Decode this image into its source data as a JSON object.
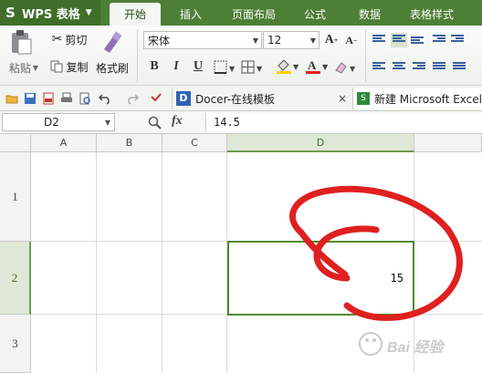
{
  "app": {
    "name": "WPS 表格"
  },
  "menu_tabs": [
    {
      "label": "开始",
      "active": true
    },
    {
      "label": "插入"
    },
    {
      "label": "页面布局"
    },
    {
      "label": "公式"
    },
    {
      "label": "数据"
    },
    {
      "label": "表格样式"
    }
  ],
  "ribbon": {
    "paste": "粘贴",
    "cut": "剪切",
    "copy": "复制",
    "format_painter": "格式刷",
    "font_name": "宋体",
    "font_size": "12",
    "bold": "B",
    "italic": "I",
    "underline": "U"
  },
  "quickbar": {
    "docer_tab": "Docer-在线模板",
    "workbook_tab": "新建 Microsoft Excel"
  },
  "formula_bar": {
    "name_box": "D2",
    "fx": "fx",
    "value": "14.5"
  },
  "sheet": {
    "columns": [
      "A",
      "B",
      "C",
      "D"
    ],
    "rows": [
      "1",
      "2",
      "3"
    ],
    "active_cell": "D2",
    "active_value": "15"
  },
  "colors": {
    "tab_bar": "#4d7f36",
    "selection": "#4f8a2e",
    "annotation": "#e0201f"
  },
  "watermark": "Bai 经验"
}
